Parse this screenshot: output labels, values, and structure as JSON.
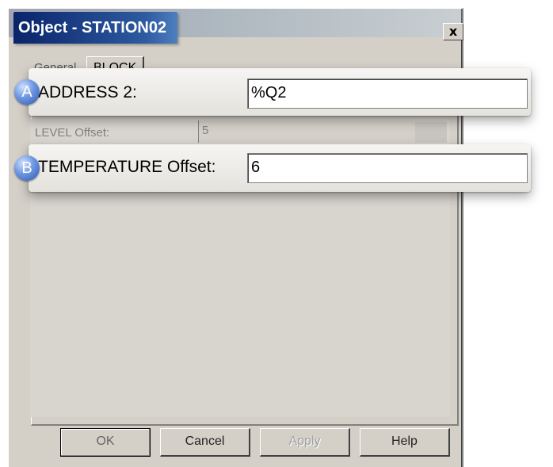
{
  "window": {
    "title": "Object - STATION02",
    "close_label": "x"
  },
  "tabs": [
    {
      "label": "General",
      "active": false
    },
    {
      "label": "BLOCK",
      "active": true
    }
  ],
  "fields": {
    "address2": {
      "badge": "A",
      "label": "ADDRESS 2:",
      "value": "%Q2"
    },
    "level_offset": {
      "label": "LEVEL Offset:",
      "value": "5",
      "disabled": true
    },
    "temperature_offset": {
      "badge": "B",
      "label": "TEMPERATURE Offset:",
      "value": "6"
    }
  },
  "buttons": {
    "ok": "OK",
    "cancel": "Cancel",
    "apply": "Apply",
    "help": "Help"
  },
  "colors": {
    "dialog_face": "#d4d0c8",
    "titlebar_start": "#0a246a",
    "badge": "#2c56b0"
  }
}
